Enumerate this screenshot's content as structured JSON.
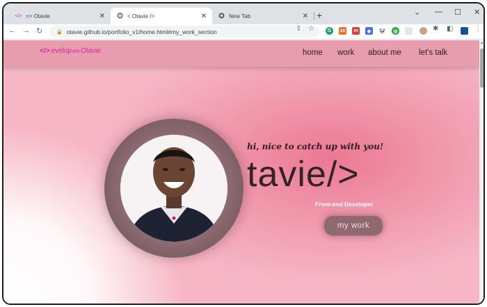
{
  "browser": {
    "tabs": [
      {
        "favicon": "</>",
        "title": "=> Otavie",
        "active": false
      },
      {
        "favicon": "globe-icon",
        "title": "< Otavie />",
        "active": true
      },
      {
        "favicon": "chrome-icon",
        "title": "New Tab",
        "active": false
      }
    ],
    "url": "otavie.github.io/portfolio_v1/home.html#my_work_section"
  },
  "site": {
    "logo_bracket": "</>",
    "logo_word1": "evelop",
    "logo_mid": "em",
    "logo_word2": "Otavie",
    "nav": [
      "home",
      "work",
      "about me",
      "let's talk"
    ],
    "greeting": "hi, nice to catch up with you!",
    "name": "tavie/>",
    "role": "Front-end Developer",
    "cta": "my work"
  },
  "colors": {
    "accent": "#d6249f",
    "nav_bg": "#e79dae",
    "page_pink": "#ec7893",
    "button_bg": "#8e6970"
  }
}
